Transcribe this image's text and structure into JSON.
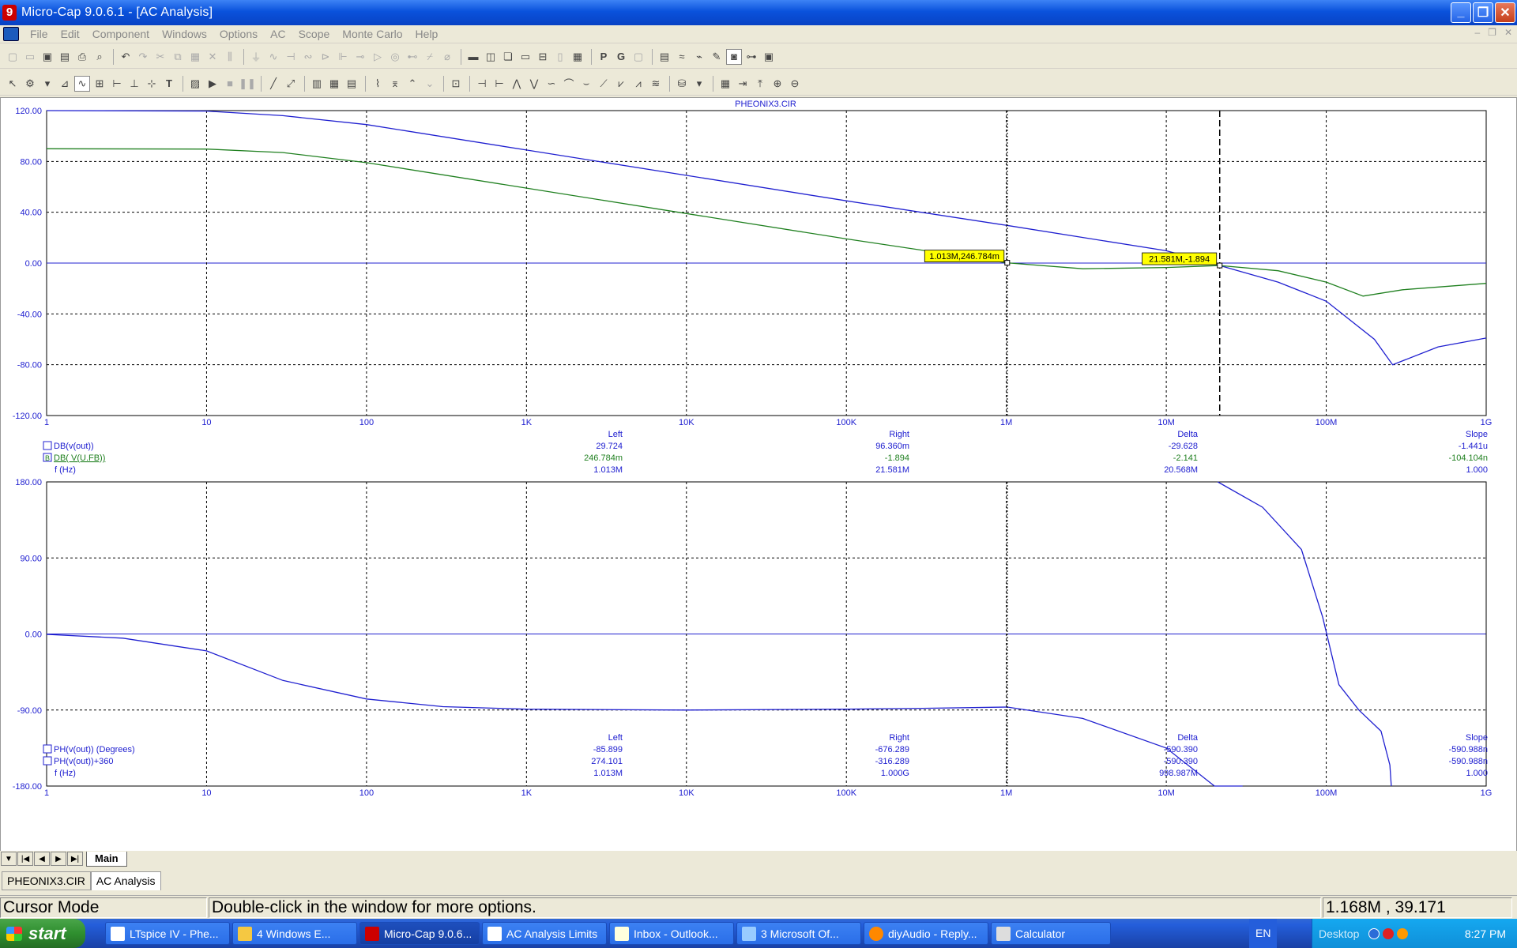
{
  "window": {
    "title": "Micro-Cap 9.0.6.1 - [AC Analysis]",
    "app_icon": "9"
  },
  "menu": [
    "File",
    "Edit",
    "Component",
    "Windows",
    "Options",
    "AC",
    "Scope",
    "Monte Carlo",
    "Help"
  ],
  "plot": {
    "circuit_name": "PHEONIX3.CIR",
    "x_ticks": [
      "1",
      "10",
      "100",
      "1K",
      "10K",
      "100K",
      "1M",
      "10M",
      "100M",
      "1G"
    ],
    "top_y_ticks": [
      "120.00",
      "80.00",
      "40.00",
      "0.00",
      "-40.00",
      "-80.00",
      "-120.00"
    ],
    "bottom_y_ticks": [
      "180.00",
      "90.00",
      "0.00",
      "-90.00",
      "-180.00"
    ],
    "cursor_labels": [
      "1.013M,246.784m",
      "21.581M,-1.894"
    ],
    "top_table": {
      "headers": [
        "Left",
        "Right",
        "Delta",
        "Slope"
      ],
      "rows": [
        {
          "name": "DB(v(out))",
          "color": "#2020d0",
          "values": [
            "29.724",
            "96.360m",
            "-29.628",
            "-1.441u"
          ]
        },
        {
          "name": "DB( V(U.FB))",
          "color": "#208020",
          "marker": "B",
          "values": [
            "246.784m",
            "-1.894",
            "-2.141",
            "-104.104n"
          ]
        },
        {
          "name": "f (Hz)",
          "color": "#2020d0",
          "values": [
            "1.013M",
            "21.581M",
            "20.568M",
            "1.000"
          ]
        }
      ]
    },
    "bottom_table": {
      "headers": [
        "Left",
        "Right",
        "Delta",
        "Slope"
      ],
      "rows": [
        {
          "name": "PH(v(out)) (Degrees)",
          "color": "#2020d0",
          "values": [
            "-85.899",
            "-676.289",
            "-590.390",
            "-590.988n"
          ]
        },
        {
          "name": "PH(v(out))+360",
          "color": "#2020d0",
          "values": [
            "274.101",
            "-316.289",
            "-590.390",
            "-590.988n"
          ]
        },
        {
          "name": "f (Hz)",
          "color": "#2020d0",
          "values": [
            "1.013M",
            "1.000G",
            "998.987M",
            "1.000"
          ]
        }
      ]
    }
  },
  "chart_data": [
    {
      "type": "line",
      "xscale": "log",
      "xlim": [
        1,
        1000000000
      ],
      "ylim": [
        -120,
        120
      ],
      "series": [
        {
          "name": "DB(v(out))",
          "color": "#2020d0",
          "x": [
            1,
            10,
            30,
            100,
            1000,
            10000,
            100000,
            1000000,
            10000000,
            21581000,
            50000000,
            100000000,
            200000000,
            260000000,
            500000000,
            1000000000
          ],
          "y": [
            120,
            119.6,
            116,
            109,
            89,
            69,
            49,
            29.7,
            9.7,
            -1.9,
            -15,
            -30,
            -60,
            -80,
            -66,
            -59
          ]
        },
        {
          "name": "DB( V(U.FB))",
          "color": "#208020",
          "x": [
            1,
            10,
            30,
            100,
            1000,
            10000,
            100000,
            1000000,
            3000000,
            10000000,
            21581000,
            50000000,
            100000000,
            170000000,
            300000000,
            1000000000
          ],
          "y": [
            90,
            89.7,
            87,
            79,
            59,
            39,
            19,
            0.25,
            -4.5,
            -3.5,
            -1.9,
            -6,
            -15,
            -26,
            -21,
            -16
          ]
        }
      ]
    },
    {
      "type": "line",
      "xscale": "log",
      "xlim": [
        1,
        1000000000
      ],
      "ylim": [
        -180,
        180
      ],
      "series": [
        {
          "name": "PH(v(out)) (Degrees)",
          "color": "#2020d0",
          "x": [
            1,
            3,
            10,
            30,
            100,
            300,
            1000,
            10000,
            100000,
            300000,
            1013000,
            3000000,
            10000000,
            20000000,
            30000000
          ],
          "y": [
            -0.5,
            -5,
            -20,
            -55,
            -77,
            -86,
            -89,
            -90,
            -89,
            -88,
            -86.5,
            -100,
            -135,
            -180,
            -180
          ]
        },
        {
          "name": "PH(v(out))+360",
          "color": "#2020d0",
          "x": [
            21000000,
            40000000,
            70000000,
            95000000,
            120000000,
            160000000,
            220000000,
            250000000,
            255000000
          ],
          "y": [
            180,
            150,
            100,
            20,
            -60,
            -90,
            -115,
            -155,
            -180
          ]
        }
      ]
    }
  ],
  "sheet_tab": "Main",
  "doc_tabs": [
    "PHEONIX3.CIR",
    "AC Analysis"
  ],
  "status": {
    "mode": "Cursor Mode",
    "hint": "Double-click in the window for more options.",
    "coords": "1.168M , 39.171"
  },
  "taskbar": {
    "start": "start",
    "tasks": [
      "LTspice IV - Phe...",
      "4 Windows E...",
      "Micro-Cap 9.0.6...",
      "AC Analysis Limits",
      "Inbox - Outlook...",
      "3 Microsoft Of...",
      "diyAudio - Reply...",
      "Calculator"
    ],
    "lang": "EN",
    "desktop": "Desktop",
    "clock": "8:27 PM"
  },
  "colors": {
    "trace_blue": "#2020d0",
    "trace_green": "#208020",
    "grid": "#000000",
    "axis_text": "#2020d0",
    "cursor_label_bg": "#ffff00"
  }
}
